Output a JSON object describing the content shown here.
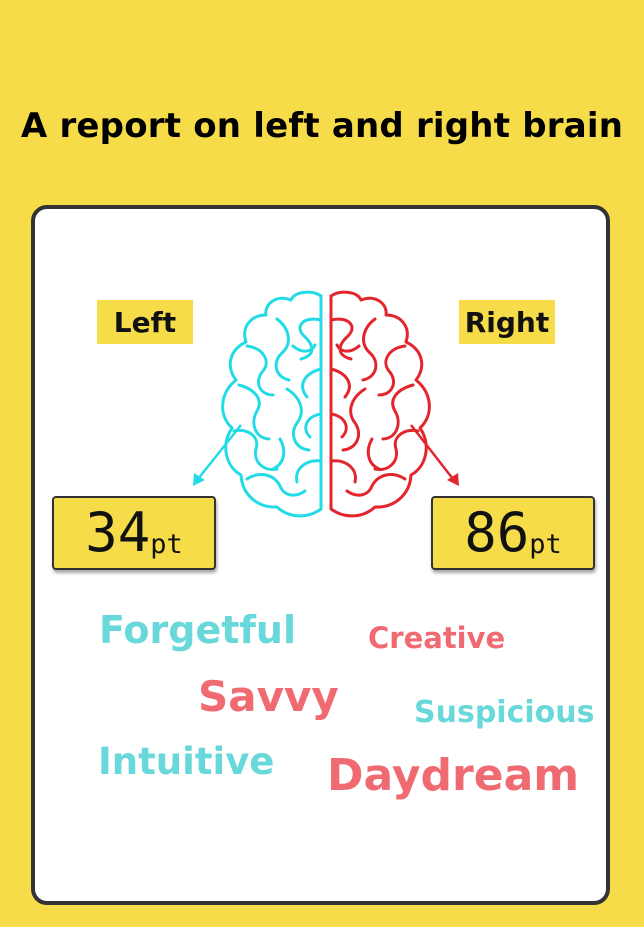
{
  "title": "A report on left and right brain",
  "colors": {
    "background": "#f7dc4a",
    "cyan": "#68d8da",
    "red": "#f06a72",
    "brain_left": "#22dbe6",
    "brain_right": "#e3262d"
  },
  "left": {
    "label": "Left",
    "score": "34",
    "unit": "pt"
  },
  "right": {
    "label": "Right",
    "score": "86",
    "unit": "pt"
  },
  "words": {
    "forgetful": "Forgetful",
    "creative": "Creative",
    "savvy": "Savvy",
    "suspicious": "Suspicious",
    "intuitive": "Intuitive",
    "daydream": "Daydream"
  },
  "icons": {
    "brain": "brain-icon",
    "left_arrow": "arrow-down-left-icon",
    "right_arrow": "arrow-down-right-icon"
  }
}
